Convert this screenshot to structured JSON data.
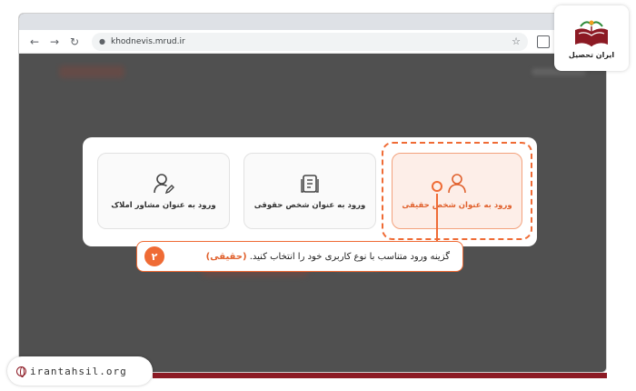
{
  "browser": {
    "url": "khodnevis.mrud.ir"
  },
  "modal": {
    "options": [
      {
        "label": "ورود به عنوان مشاور املاک",
        "icon": "user-edit-icon"
      },
      {
        "label": "ورود به عنوان شخص حقوقی",
        "icon": "building-doc-icon"
      },
      {
        "label": "ورود به عنوان شخص حقیقی",
        "icon": "user-icon"
      }
    ]
  },
  "callout": {
    "step": "۲",
    "text_main": "گزینه ورود متناسب با نوع کاربری خود را انتخاب کنید.",
    "text_accent": "(حقیقی)"
  },
  "branding": {
    "logo_text": "ایران تحصیل",
    "website": "irantahsil.org"
  },
  "colors": {
    "accent": "#ef6b35",
    "brand": "#8c1a24"
  }
}
